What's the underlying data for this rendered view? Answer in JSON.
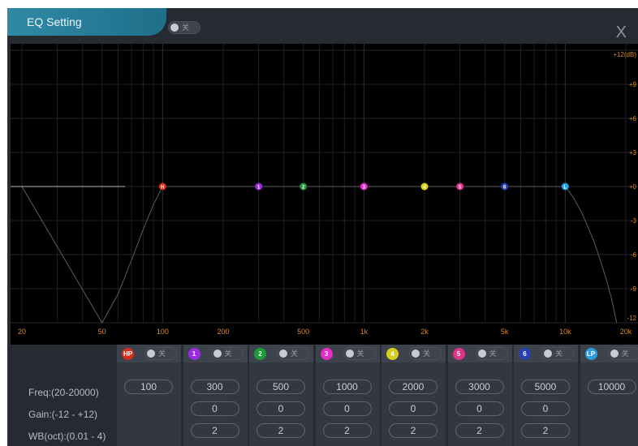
{
  "window": {
    "title": "EQ Setting",
    "master_toggle": "关",
    "close": "X"
  },
  "chart_data": {
    "type": "line",
    "xscale": "log",
    "xlim": [
      20,
      20000
    ],
    "ylim": [
      -12,
      12
    ],
    "xticks": [
      "20",
      "50",
      "100",
      "200",
      "500",
      "1k",
      "2k",
      "5k",
      "10k",
      "20k"
    ],
    "xtick_values": [
      20,
      50,
      100,
      200,
      500,
      1000,
      2000,
      5000,
      10000,
      20000
    ],
    "yticks": [
      "+12(dB)",
      "+9",
      "+6",
      "+3",
      "+0",
      "-3",
      "-6",
      "-9",
      "-12"
    ],
    "ytick_values": [
      12,
      9,
      6,
      3,
      0,
      -3,
      -6,
      -9,
      -12
    ],
    "nodes": [
      {
        "label": "H",
        "freq": 100,
        "gain": 0,
        "color": "#d62d1e"
      },
      {
        "label": "1",
        "freq": 300,
        "gain": 0,
        "color": "#9b2be0"
      },
      {
        "label": "2",
        "freq": 500,
        "gain": 0,
        "color": "#1f9a3a"
      },
      {
        "label": "3",
        "freq": 1000,
        "gain": 0,
        "color": "#e62bc7"
      },
      {
        "label": "4",
        "freq": 2000,
        "gain": 0,
        "color": "#d8cf1a"
      },
      {
        "label": "5",
        "freq": 3000,
        "gain": 0,
        "color": "#e0338a"
      },
      {
        "label": "6",
        "freq": 5000,
        "gain": 0,
        "color": "#2a3fb0"
      },
      {
        "label": "L",
        "freq": 10000,
        "gain": 0,
        "color": "#2a9fe0"
      }
    ],
    "curve": {
      "x": [
        20,
        50,
        60,
        70,
        80,
        90,
        100,
        10000,
        11000,
        12000,
        13000,
        14000,
        15000,
        16000,
        17000,
        18000
      ],
      "y": [
        0,
        -12,
        -9.5,
        -6.5,
        -3.8,
        -1.6,
        0,
        0,
        -1.0,
        -2.2,
        -3.6,
        -5.0,
        -6.6,
        -8.2,
        -9.9,
        -12
      ]
    }
  },
  "labels": {
    "freq": "Freq:(20-20000)",
    "gain": "Gain:(-12 - +12)",
    "wb": "WB(oct):(0.01 - 4)"
  },
  "bands": [
    {
      "id": "HP",
      "color": "#d62d1e",
      "toggle": "关",
      "freq": "100",
      "gain": null,
      "wb": null
    },
    {
      "id": "1",
      "color": "#9b2be0",
      "toggle": "关",
      "freq": "300",
      "gain": "0",
      "wb": "2"
    },
    {
      "id": "2",
      "color": "#1f9a3a",
      "toggle": "关",
      "freq": "500",
      "gain": "0",
      "wb": "2"
    },
    {
      "id": "3",
      "color": "#e62bc7",
      "toggle": "关",
      "freq": "1000",
      "gain": "0",
      "wb": "2"
    },
    {
      "id": "4",
      "color": "#d8cf1a",
      "toggle": "关",
      "freq": "2000",
      "gain": "0",
      "wb": "2"
    },
    {
      "id": "5",
      "color": "#e0338a",
      "toggle": "关",
      "freq": "3000",
      "gain": "0",
      "wb": "2"
    },
    {
      "id": "6",
      "color": "#2a3fb0",
      "toggle": "关",
      "freq": "5000",
      "gain": "0",
      "wb": "2"
    },
    {
      "id": "LP",
      "color": "#2a9fe0",
      "toggle": "关",
      "freq": "10000",
      "gain": null,
      "wb": null
    }
  ]
}
